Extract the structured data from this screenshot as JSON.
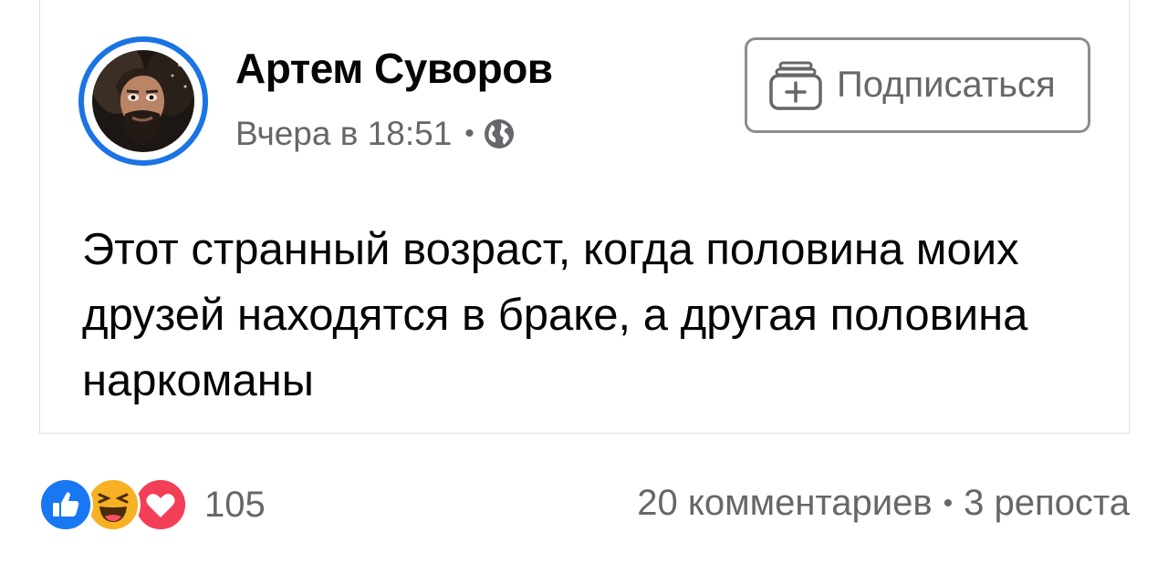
{
  "post": {
    "author": "Артем Суворов",
    "timestamp": "Вчера в 18:51",
    "separator": "•",
    "privacy_icon": "globe-icon",
    "follow_label": "Подписаться",
    "text": "Этот странный возраст, когда половина моих друзей находятся в браке, а другая половина наркоманы"
  },
  "footer": {
    "reactions": [
      "like-icon",
      "haha-icon",
      "love-icon"
    ],
    "reaction_count": "105",
    "comments": "20 комментариев",
    "separator": "•",
    "shares": "3 репоста"
  },
  "colors": {
    "accent": "#1b74e4",
    "text": "#050505",
    "secondary": "#65676b",
    "like": "#1877f2",
    "haha": "#f7b125",
    "love": "#f33e58"
  }
}
